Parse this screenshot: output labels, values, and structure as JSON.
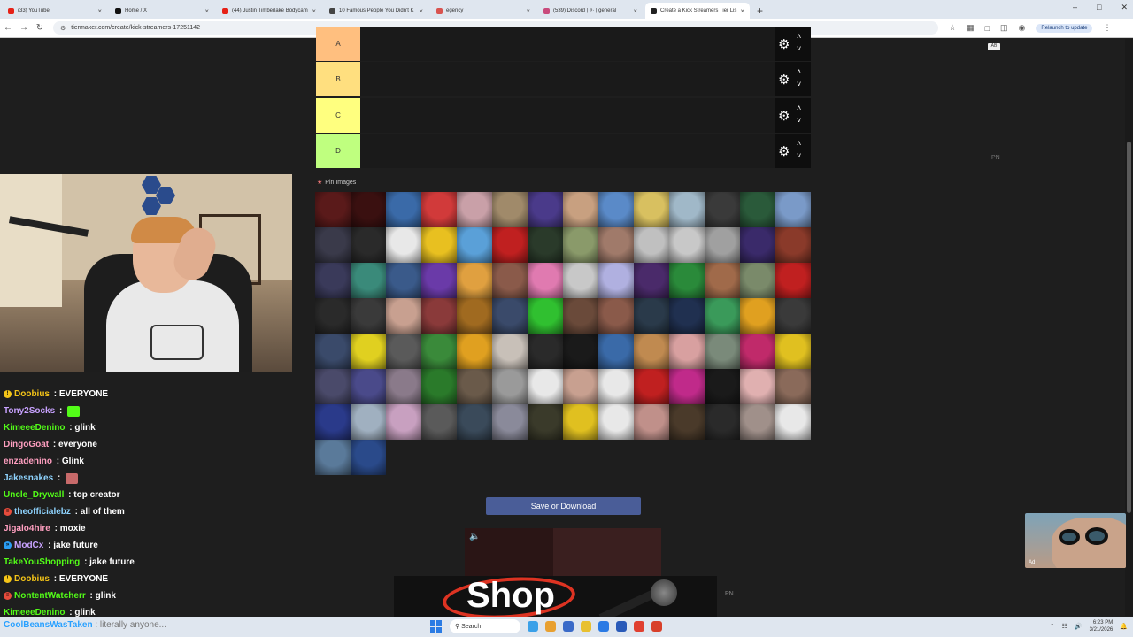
{
  "browser": {
    "tabs": [
      {
        "label": "(33) YouTube",
        "color": "#e62117",
        "active": false
      },
      {
        "label": "Home / X",
        "color": "#111111",
        "active": false
      },
      {
        "label": "(44) Justin Timberlake Bodycam",
        "color": "#e62117",
        "active": false
      },
      {
        "label": "10 Famous People You Didn't K",
        "color": "#444444",
        "active": false
      },
      {
        "label": "egency",
        "color": "#d9534f",
        "active": false
      },
      {
        "label": "(539) Discord | #· | general",
        "color": "#c94a7c",
        "active": false
      },
      {
        "label": "Create a Kick Streamers Tier Lis",
        "color": "#222222",
        "active": true
      }
    ],
    "url": "tiermaker.com/create/kick-streamers-17251142",
    "relaunch_label": "Relaunch to update"
  },
  "tiers": [
    {
      "label": "A",
      "color": "#ffbf7f"
    },
    {
      "label": "B",
      "color": "#ffdf7f"
    },
    {
      "label": "C",
      "color": "#ffff7f"
    },
    {
      "label": "D",
      "color": "#bfff7f"
    }
  ],
  "pin_images_label": "Pin Images",
  "save_button_label": "Save or Download",
  "ad": {
    "banner_text": "Shop",
    "pn": "PN",
    "facecam_label": "Ad"
  },
  "side": {
    "pn": "PN",
    "button": "AB"
  },
  "grid_colors": [
    "#5a1a1a",
    "#3a1010",
    "#3a6aa8",
    "#d13a3a",
    "#c9a0a8",
    "#a08a6a",
    "#4a3a8a",
    "#c8a080",
    "#5a8ac8",
    "#d8c060",
    "#a0b8c8",
    "#3a3a3a",
    "#2a5a3a",
    "#7a9ac8",
    "#3a3a4a",
    "#2a2a2a",
    "#e8e8e8",
    "#e8c020",
    "#5aa0d8",
    "#c02020",
    "#2a3a2a",
    "#8a9a6a",
    "#a07a6a",
    "#c0c0c0",
    "#c8c8c8",
    "#a0a0a0",
    "#3a2a6a",
    "#8a3a2a",
    "#3a3a5a",
    "#3a8a7a",
    "#3a5a8a",
    "#6a3aa8",
    "#e0a040",
    "#8a5a4a",
    "#e07ab0",
    "#c8c8c8",
    "#b0b0e0",
    "#4a2a6a",
    "#2a8a3a",
    "#a06a4a",
    "#7a8a6a",
    "#c02020",
    "#2a2a2a",
    "#3a3a3a",
    "#c8a090",
    "#8a3a3a",
    "#a06a20",
    "#3a4a6a",
    "#30c030",
    "#6a4a3a",
    "#8a5a4a",
    "#2a3a4a",
    "#203050",
    "#3a9a5a",
    "#e0a020",
    "#3a3a3a",
    "#3a4a6a",
    "#e0d020",
    "#5a5a5a",
    "#3a8a3a",
    "#e0a020",
    "#c8c0b8",
    "#2a2a2a",
    "#1a1a1a",
    "#3a6aa8",
    "#c08a50",
    "#d8a0a0",
    "#7a8a7a",
    "#c02a6a",
    "#e0c020",
    "#4a4a6a",
    "#4a4a8a",
    "#8a7a8a",
    "#2a7a2a",
    "#6a5a4a",
    "#9a9a9a",
    "#e8e8e8",
    "#c8a090",
    "#e8e8e8",
    "#c02020",
    "#c02a8a",
    "#1a1a1a",
    "#e0b0b0",
    "#8a6a5a",
    "#2a3a8a",
    "#a0b0c0",
    "#c8a0c0",
    "#5a5a5a",
    "#3a4a5a",
    "#8a8a9a",
    "#3a3a2a",
    "#e0c020",
    "#e8e8e8",
    "#c0908a",
    "#4a3a2a",
    "#2a2a2a",
    "#a0908a",
    "#e8e8e8",
    "#5a7a9a",
    "#2a4a8a"
  ],
  "chat": [
    {
      "user": "Doobius",
      "color": "#f5c518",
      "badge": "#f5c518",
      "badge_text": "!",
      "msg": " : EVERYONE",
      "emote": ""
    },
    {
      "user": "Tony2Socks",
      "color": "#c8a2ff",
      "badge": "",
      "badge_text": "",
      "msg": " : ",
      "emote": "#53fc18"
    },
    {
      "user": "KimeeeDenino",
      "color": "#53fc18",
      "badge": "",
      "badge_text": "",
      "msg": " : glink",
      "emote": ""
    },
    {
      "user": "DingoGoat",
      "color": "#ff9fc0",
      "badge": "",
      "badge_text": "",
      "msg": " : everyone",
      "emote": ""
    },
    {
      "user": "enzadenino",
      "color": "#ff9fc0",
      "badge": "",
      "badge_text": "",
      "msg": " : Glink",
      "emote": ""
    },
    {
      "user": "Jakesnakes",
      "color": "#8fd4ff",
      "badge": "",
      "badge_text": "",
      "msg": " : ",
      "emote": "#c86a6a"
    },
    {
      "user": "Uncle_Drywall",
      "color": "#53fc18",
      "badge": "",
      "badge_text": "",
      "msg": " : top creator",
      "emote": ""
    },
    {
      "user": "theofficialebz",
      "color": "#8fd4ff",
      "badge": "#e74c3c",
      "badge_text": "≡",
      "msg": " : all of them",
      "emote": ""
    },
    {
      "user": "Jigalo4hire",
      "color": "#ff9fc0",
      "badge": "",
      "badge_text": "",
      "msg": " : moxie",
      "emote": ""
    },
    {
      "user": "ModCx",
      "color": "#c8a2ff",
      "badge": "#2a9df4",
      "badge_text": "»",
      "msg": " : jake future",
      "emote": ""
    },
    {
      "user": "TakeYouShopping",
      "color": "#53fc18",
      "badge": "",
      "badge_text": "",
      "msg": " : jake future",
      "emote": ""
    },
    {
      "user": "Doobius",
      "color": "#f5c518",
      "badge": "#f5c518",
      "badge_text": "!",
      "msg": " : EVERYONE",
      "emote": ""
    },
    {
      "user": "NontentWatcherr",
      "color": "#53fc18",
      "badge": "#e74c3c",
      "badge_text": "≡",
      "msg": " : glink",
      "emote": ""
    },
    {
      "user": "KimeeeDenino",
      "color": "#53fc18",
      "badge": "",
      "badge_text": "",
      "msg": " : glink",
      "emote": ""
    }
  ],
  "taskbar": {
    "chat_user": "CoolBeansWasTaken",
    "chat_msg": " : literally anyone...",
    "search_label": "Search",
    "time": "6:23 PM",
    "date": "3/21/2026",
    "apps": [
      "#3aa0e8",
      "#e8a030",
      "#3a6ac8",
      "#e8c030",
      "#2a7ae4",
      "#2a5ab8",
      "#e04030",
      "#d8402a"
    ]
  }
}
